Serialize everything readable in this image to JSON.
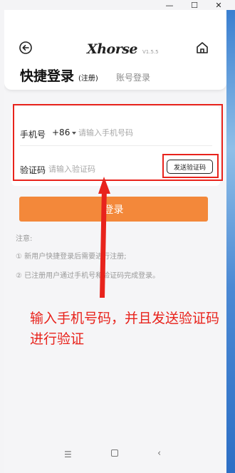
{
  "window": {
    "minimize_glyph": "—",
    "maximize_glyph": "☐",
    "close_glyph": "✕"
  },
  "header": {
    "logo": "Xhorse",
    "version": "V1.5.5",
    "back_icon": "back-arrow-icon",
    "home_icon": "home-icon"
  },
  "tabs": {
    "quick_login": "快捷登录",
    "register_note": "(注册)",
    "account_login": "账号登录"
  },
  "form": {
    "phone_label": "手机号",
    "country_code": "+86",
    "phone_placeholder": "请输入手机号码",
    "code_label": "验证码",
    "code_placeholder": "请输入验证码",
    "send_code_button": "发送验证码"
  },
  "login_button": "登录",
  "notes": {
    "title": "注意:",
    "items": [
      "① 新用户快捷登录后需要进行注册;",
      "② 已注册用户通过手机号和验证码完成登录。"
    ]
  },
  "annotation": "输入手机号码，并且发送验证码进行验证",
  "colors": {
    "accent": "#f3883a",
    "annotation_red": "#e8231c"
  },
  "bottom_nav": {
    "menu_glyph": "☰",
    "back_glyph": "‹"
  }
}
